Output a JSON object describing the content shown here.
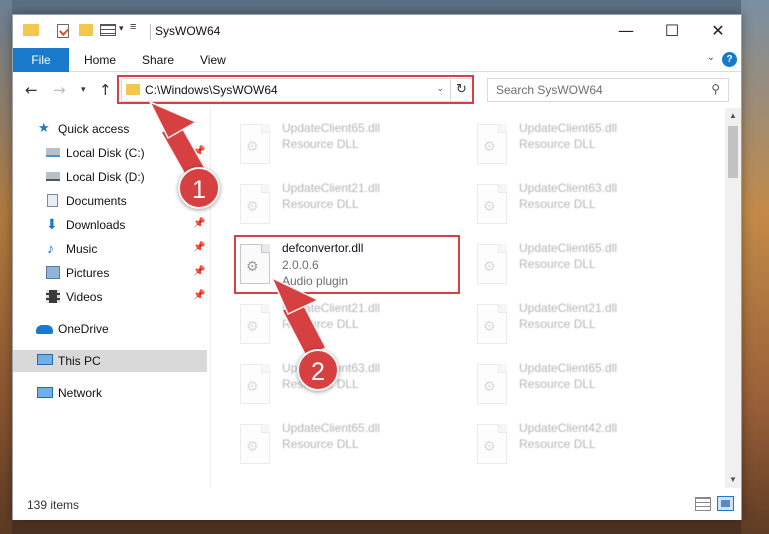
{
  "window": {
    "title": "SysWOW64",
    "controls": [
      "—",
      "☐",
      "✕"
    ]
  },
  "ribbon": {
    "tabs": [
      "File",
      "Home",
      "Share",
      "View"
    ],
    "help": "?"
  },
  "address_bar": {
    "path": "C:\\Windows\\SysWOW64",
    "search_placeholder": "Search SysWOW64"
  },
  "sidebar": {
    "quick_access": "Quick access",
    "items": [
      {
        "label": "Local Disk (C:)",
        "icon": "drive-icon",
        "pinned": true
      },
      {
        "label": "Local Disk (D:)",
        "icon": "drive-icon",
        "pinned": false
      },
      {
        "label": "Documents",
        "icon": "documents-icon",
        "pinned": true
      },
      {
        "label": "Downloads",
        "icon": "downloads-icon",
        "pinned": true
      },
      {
        "label": "Music",
        "icon": "music-icon",
        "pinned": true
      },
      {
        "label": "Pictures",
        "icon": "pictures-icon",
        "pinned": true
      },
      {
        "label": "Videos",
        "icon": "videos-icon",
        "pinned": true
      }
    ],
    "onedrive": "OneDrive",
    "this_pc": "This PC",
    "network": "Network"
  },
  "files": [
    {
      "name": "UpdateClient65.dll",
      "type": "Resource DLL"
    },
    {
      "name": "UpdateClient65.dll",
      "type": "Resource DLL"
    },
    {
      "name": "UpdateClient21.dll",
      "type": "Resource DLL"
    },
    {
      "name": "UpdateClient63.dll",
      "type": "Resource DLL"
    },
    {
      "name": "defconvertor.dll",
      "version": "2.0.0.6",
      "type": "Audio plugin",
      "highlighted": true
    },
    {
      "name": "UpdateClient65.dll",
      "type": "Resource DLL"
    },
    {
      "name": "UpdateClient21.dll",
      "type": "Resource DLL"
    },
    {
      "name": "UpdateClient21.dll",
      "type": "Resource DLL"
    },
    {
      "name": "UpdateClient63.dll",
      "type": "Resource DLL"
    },
    {
      "name": "UpdateClient65.dll",
      "type": "Resource DLL"
    },
    {
      "name": "UpdateClient65.dll",
      "type": "Resource DLL"
    },
    {
      "name": "UpdateClient42.dll",
      "type": "Resource DLL"
    }
  ],
  "status": {
    "item_count": "139 items"
  },
  "annotations": {
    "step1": "1",
    "step2": "2",
    "color": "#d64040"
  }
}
